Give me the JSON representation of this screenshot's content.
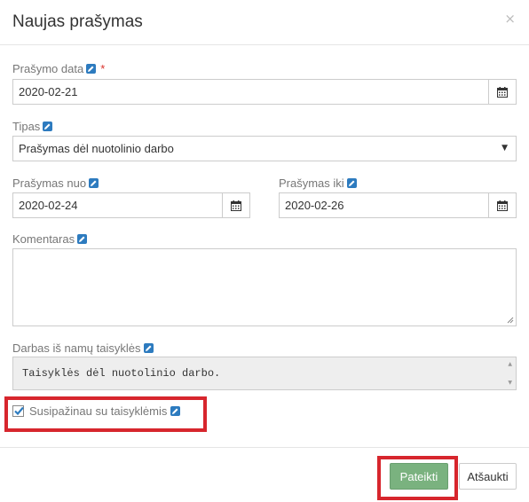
{
  "dialog": {
    "title": "Naujas prašymas",
    "close_label": "×"
  },
  "form": {
    "request_date": {
      "label": "Prašymo data",
      "required_mark": "*",
      "value": "2020-02-21"
    },
    "type": {
      "label": "Tipas",
      "value": "Prašymas dėl nuotolinio darbo",
      "caret": "▼"
    },
    "request_from": {
      "label": "Prašymas nuo",
      "value": "2020-02-24"
    },
    "request_to": {
      "label": "Prašymas iki",
      "value": "2020-02-26"
    },
    "comment": {
      "label": "Komentaras",
      "value": ""
    },
    "rules": {
      "label": "Darbas iš namų taisyklės",
      "value": "Taisyklės dėl nuotolinio darbo."
    },
    "acknowledge": {
      "label": "Susipažinau su taisyklėmis",
      "checked": true
    }
  },
  "footer": {
    "submit_label": "Pateikti",
    "cancel_label": "Atšaukti"
  },
  "colors": {
    "highlight": "#d7262d",
    "submit_bg": "#7ab27f",
    "edit_icon": "#2d7bbf",
    "required": "#d9312b"
  },
  "icons": [
    "edit-icon",
    "calendar-icon",
    "close-icon",
    "caret-down-icon",
    "checkmark-icon",
    "resize-handle-icon"
  ]
}
